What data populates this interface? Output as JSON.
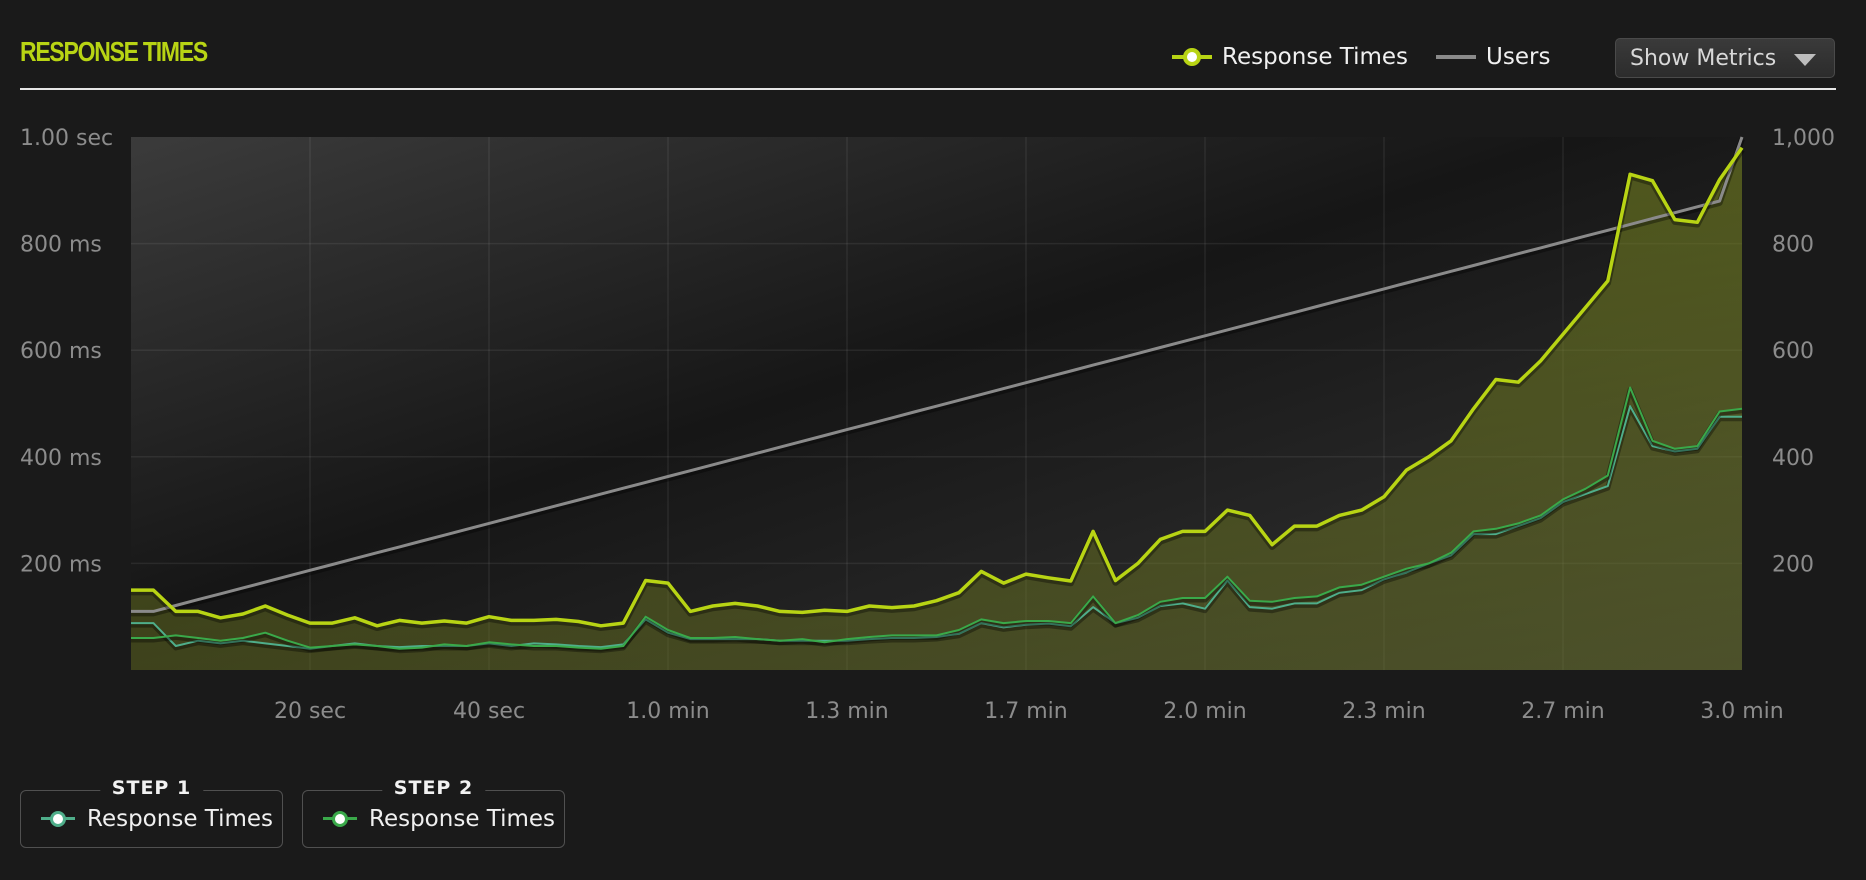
{
  "header": {
    "title": "RESPONSE TIMES",
    "show_metrics_label": "Show Metrics"
  },
  "legend": {
    "response_times": "Response Times",
    "users": "Users"
  },
  "steps": [
    {
      "label": "STEP 1",
      "series_label": "Response Times",
      "color": "#4fae8a"
    },
    {
      "label": "STEP 2",
      "series_label": "Response Times",
      "color": "#3aa94a"
    }
  ],
  "colors": {
    "accent": "#b8d414",
    "users_line": "#8a8a8a",
    "step1": "#4fae8a",
    "step2": "#3aa94a",
    "background": "#1a1a1a"
  },
  "chart_data": {
    "type": "line",
    "x_unit": "seconds",
    "xlim": [
      0,
      180
    ],
    "x_ticks": [
      {
        "x": 20,
        "label": "20 sec"
      },
      {
        "x": 40,
        "label": "40 sec"
      },
      {
        "x": 60,
        "label": "1.0 min"
      },
      {
        "x": 80,
        "label": "1.3 min"
      },
      {
        "x": 100,
        "label": "1.7 min"
      },
      {
        "x": 120,
        "label": "2.0 min"
      },
      {
        "x": 140,
        "label": "2.3 min"
      },
      {
        "x": 160,
        "label": "2.7 min"
      },
      {
        "x": 180,
        "label": "3.0 min"
      }
    ],
    "y_left": {
      "unit": "ms",
      "ylim": [
        0,
        1000
      ],
      "ticks": [
        {
          "v": 200,
          "label": "200 ms"
        },
        {
          "v": 400,
          "label": "400 ms"
        },
        {
          "v": 600,
          "label": "600 ms"
        },
        {
          "v": 800,
          "label": "800 ms"
        },
        {
          "v": 1000,
          "label": "1.00 sec"
        }
      ]
    },
    "y_right": {
      "ylim": [
        0,
        1000
      ],
      "ticks": [
        {
          "v": 200,
          "label": "200"
        },
        {
          "v": 400,
          "label": "400"
        },
        {
          "v": 600,
          "label": "600"
        },
        {
          "v": 800,
          "label": "800"
        },
        {
          "v": 1000,
          "label": "1,000"
        }
      ]
    },
    "x": [
      0,
      2.5,
      5,
      7.5,
      10,
      12.5,
      15,
      17.5,
      20,
      22.5,
      25,
      27.5,
      30,
      32.5,
      35,
      37.5,
      40,
      42.5,
      45,
      47.5,
      50,
      52.5,
      55,
      57.5,
      60,
      62.5,
      65,
      67.5,
      70,
      72.5,
      75,
      77.5,
      80,
      82.5,
      85,
      87.5,
      90,
      92.5,
      95,
      97.5,
      100,
      102.5,
      105,
      107.5,
      110,
      112.5,
      115,
      117.5,
      120,
      122.5,
      125,
      127.5,
      130,
      132.5,
      135,
      137.5,
      140,
      142.5,
      145,
      147.5,
      150,
      152.5,
      155,
      157.5,
      160,
      162.5,
      165,
      167.5,
      170,
      172.5,
      175,
      177.5,
      180
    ],
    "series": [
      {
        "name": "Response Times",
        "axis": "left",
        "values": [
          150,
          150,
          110,
          110,
          98,
          105,
          120,
          103,
          88,
          88,
          98,
          83,
          93,
          88,
          92,
          88,
          100,
          93,
          93,
          95,
          91,
          83,
          88,
          168,
          163,
          110,
          120,
          125,
          120,
          110,
          108,
          112,
          110,
          120,
          117,
          120,
          130,
          145,
          185,
          163,
          180,
          173,
          167,
          260,
          168,
          200,
          245,
          260,
          260,
          300,
          290,
          235,
          270,
          270,
          290,
          300,
          325,
          375,
          400,
          430,
          490,
          545,
          540,
          580,
          630,
          680,
          730,
          930,
          918,
          845,
          840,
          920,
          980
        ]
      },
      {
        "name": "Response Times",
        "axis": "left",
        "values": [
          88,
          88,
          45,
          55,
          50,
          55,
          50,
          45,
          40,
          45,
          50,
          45,
          43,
          45,
          45,
          45,
          50,
          45,
          50,
          48,
          45,
          43,
          48,
          95,
          70,
          58,
          58,
          58,
          58,
          55,
          55,
          55,
          55,
          58,
          60,
          60,
          62,
          68,
          88,
          80,
          85,
          87,
          82,
          118,
          88,
          98,
          120,
          125,
          115,
          168,
          118,
          115,
          125,
          125,
          145,
          150,
          170,
          183,
          200,
          215,
          255,
          255,
          270,
          285,
          315,
          330,
          345,
          495,
          420,
          410,
          415,
          475,
          475
        ]
      },
      {
        "name": "Response Times",
        "axis": "left",
        "values": [
          60,
          60,
          65,
          60,
          55,
          60,
          70,
          55,
          42,
          45,
          48,
          45,
          40,
          42,
          48,
          45,
          52,
          48,
          45,
          45,
          42,
          40,
          45,
          100,
          75,
          60,
          60,
          62,
          58,
          55,
          58,
          52,
          58,
          62,
          65,
          65,
          65,
          75,
          95,
          88,
          92,
          92,
          88,
          138,
          88,
          103,
          128,
          135,
          135,
          175,
          130,
          128,
          135,
          138,
          155,
          160,
          175,
          190,
          200,
          220,
          260,
          265,
          275,
          290,
          320,
          340,
          365,
          530,
          430,
          415,
          420,
          485,
          490
        ]
      },
      {
        "name": "Users",
        "axis": "right",
        "values": [
          110,
          110,
          121,
          132,
          143,
          154,
          165,
          176,
          187,
          198,
          209,
          220,
          231,
          242,
          253,
          264,
          275,
          286,
          297,
          308,
          319,
          330,
          341,
          352,
          363,
          374,
          385,
          396,
          407,
          418,
          429,
          440,
          451,
          462,
          473,
          484,
          495,
          506,
          517,
          528,
          539,
          550,
          561,
          572,
          583,
          594,
          605,
          616,
          627,
          638,
          649,
          660,
          671,
          682,
          693,
          704,
          715,
          726,
          737,
          748,
          759,
          770,
          781,
          792,
          803,
          814,
          825,
          836,
          847,
          858,
          869,
          880,
          1000
        ]
      }
    ]
  }
}
